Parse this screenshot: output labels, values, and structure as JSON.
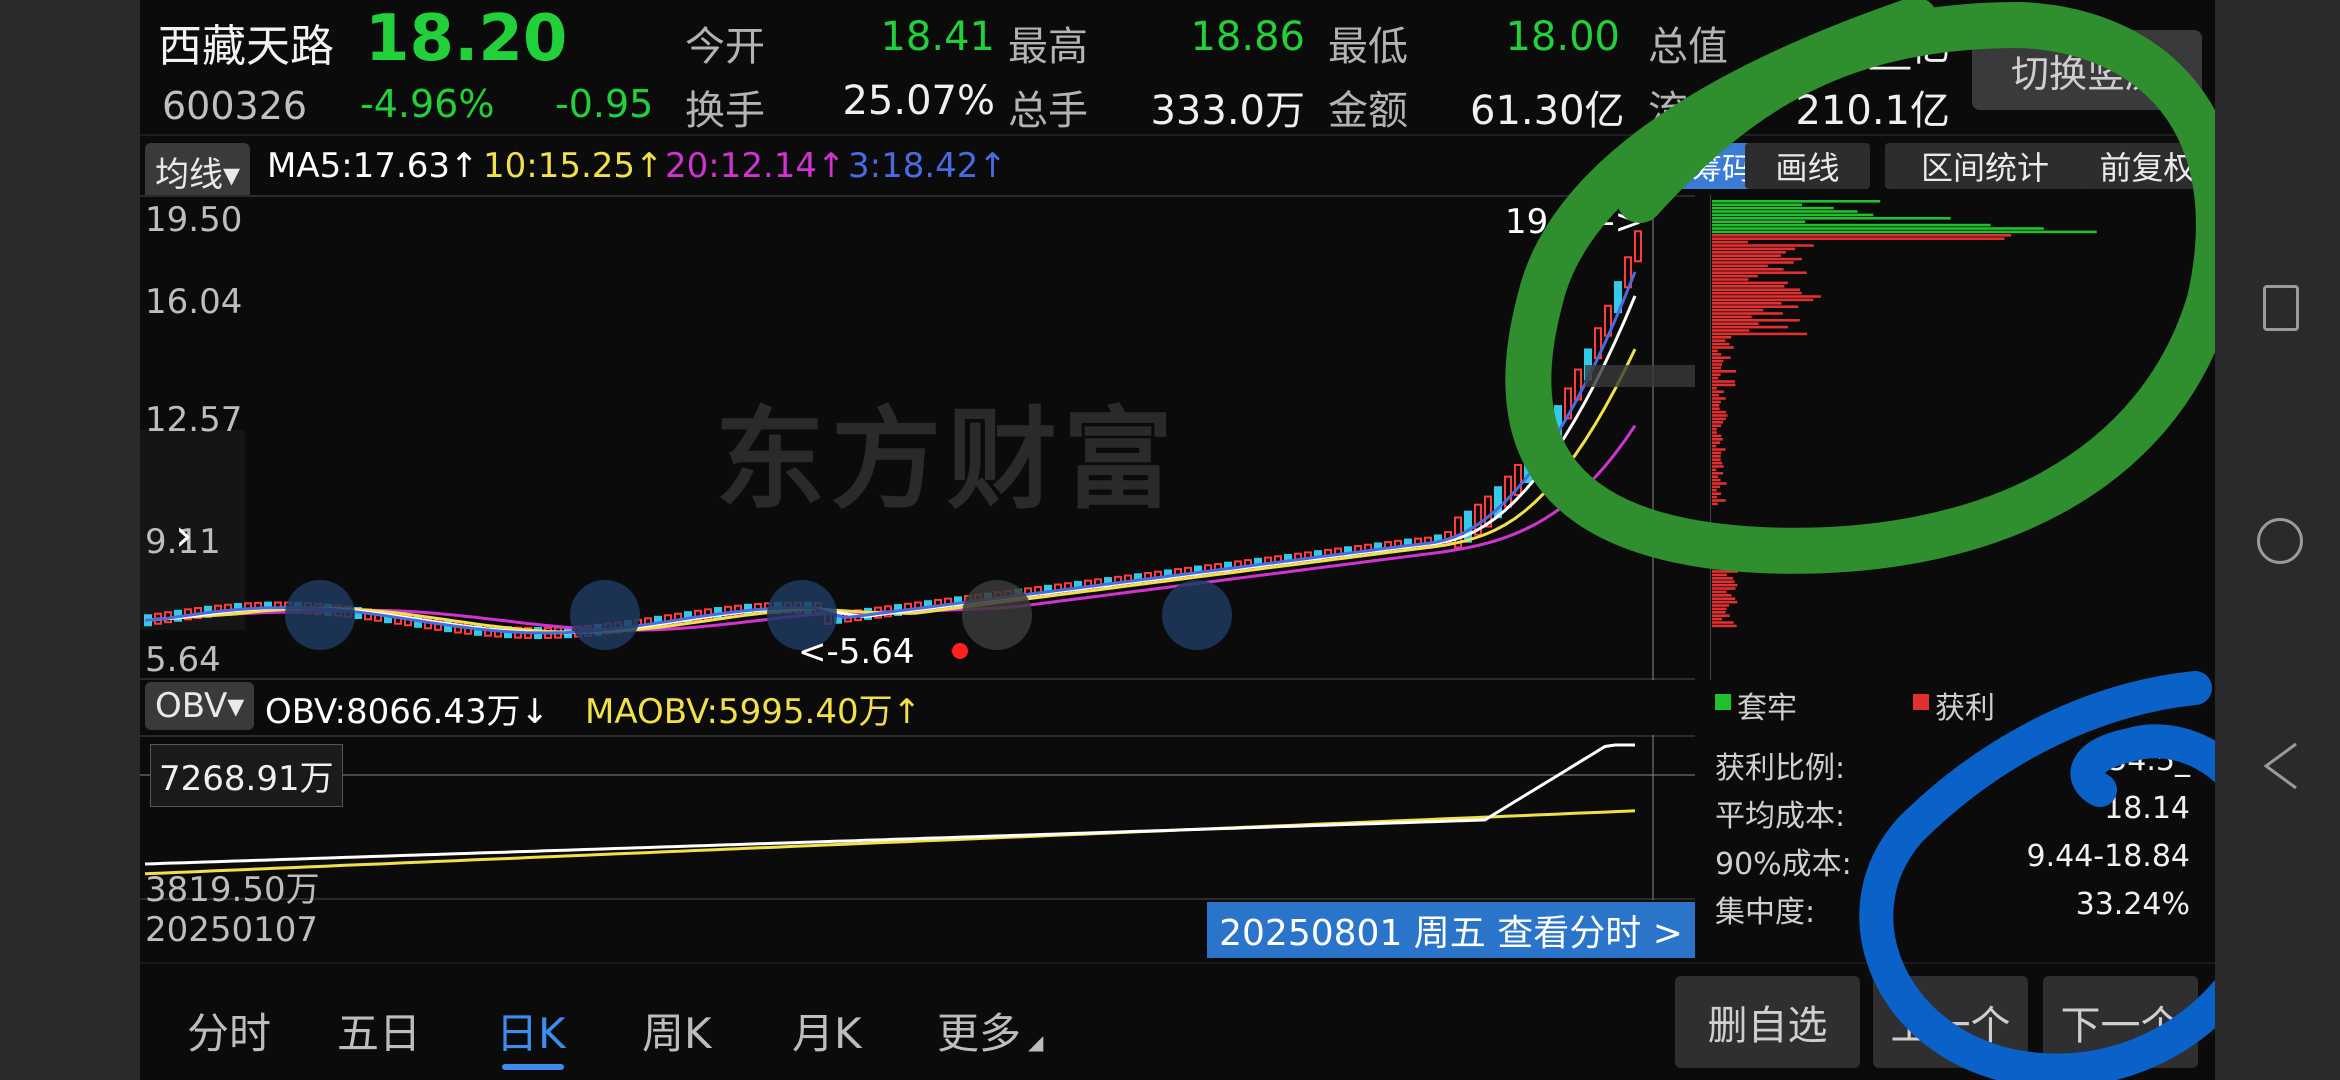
{
  "header": {
    "stock_name": "西藏天路",
    "price": "18.20",
    "code": "600326",
    "change_pct": "-4.96%",
    "change_amt": "-0.95",
    "stats": [
      {
        "label": "今开",
        "value": "18.41"
      },
      {
        "label": "最高",
        "value": "18.86"
      },
      {
        "label": "最低",
        "value": "18.00"
      },
      {
        "label": "总值",
        "value": "2__亿"
      },
      {
        "label": "换手",
        "value": "25.07%"
      },
      {
        "label": "总手",
        "value": "333.0万"
      },
      {
        "label": "金额",
        "value": "61.30亿"
      },
      {
        "label": "流",
        "value": "210.1亿"
      }
    ],
    "switch_button": "切换竖屏"
  },
  "ma_bar": {
    "selector": "均线▾",
    "ma5": "MA5:17.63↑",
    "ma10": "10:15.25↑",
    "ma20": "20:12.14↑",
    "ma3": "3:18.42↑",
    "tag": "筹码",
    "draw": "画线",
    "range_stats": "区间统计",
    "adjust": "前复权"
  },
  "colors": {
    "ma5": "#ffffff",
    "ma10": "#f2e04a",
    "ma20": "#d133d1",
    "ma3": "#4a6be0"
  },
  "price_axis": [
    "19.50",
    "16.04",
    "12.57",
    "9.11",
    "5.64"
  ],
  "annotations": {
    "high_marker": "19.50->",
    "low_marker": "<-5.64",
    "watermark": "东方财富"
  },
  "obv": {
    "selector": "OBV▾",
    "obv_text": "OBV:8066.43万↓",
    "maobv_text": "MAOBV:5995.40万↑",
    "crosshair_value": "7268.91万",
    "low_value": "3819.50万",
    "start_date": "20250107"
  },
  "cursor_date": "20250801 周五 查看分时 >",
  "chips": {
    "legend_trap": "套牢",
    "legend_profit": "获利",
    "rows": [
      {
        "label": "获利比例:",
        "value": "54.5_"
      },
      {
        "label": "平均成本:",
        "value": "18.14"
      },
      {
        "label": "90%成本:",
        "value": "9.44-18.84"
      },
      {
        "label": "集中度:",
        "value": "33.24%"
      }
    ]
  },
  "tabs": [
    {
      "label": "分时"
    },
    {
      "label": "五日"
    },
    {
      "label": "日K"
    },
    {
      "label": "周K"
    },
    {
      "label": "月K"
    },
    {
      "label": "更多"
    }
  ],
  "bottom_buttons": {
    "remove": "删自选",
    "prev": "上一个",
    "next": "下一个"
  }
}
